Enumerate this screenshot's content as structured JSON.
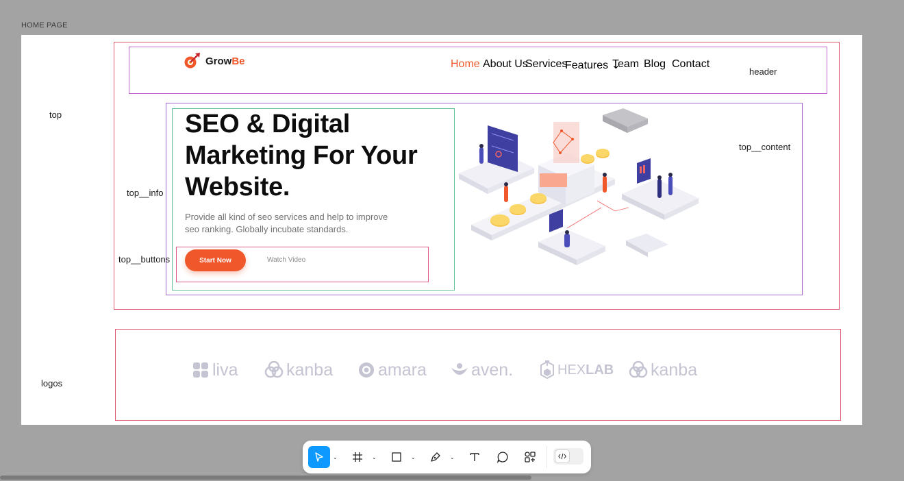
{
  "frame": {
    "title": "HOME PAGE"
  },
  "annotations": {
    "top": "top",
    "header": "header",
    "top_content": "top__content",
    "top_info": "top__info",
    "top_buttons": "top__buttons",
    "logos": "logos"
  },
  "header": {
    "logo_part1": "Grow",
    "logo_part2": "Be",
    "nav": [
      {
        "label": "Home",
        "active": true
      },
      {
        "label": "About Us"
      },
      {
        "label": "Services"
      },
      {
        "label": "Features ⌄"
      },
      {
        "label": "Team"
      },
      {
        "label": "Blog"
      },
      {
        "label": "Contact"
      }
    ]
  },
  "hero": {
    "title": "SEO & Digital Marketing For Your Website.",
    "description": "Provide all kind of seo services and help to improve seo ranking. Globally incubate standards.",
    "primary_button": "Start Now",
    "secondary_button": "Watch Video"
  },
  "logos": [
    {
      "name": "liva"
    },
    {
      "name": "kanba"
    },
    {
      "name": "amara"
    },
    {
      "name": "aven."
    },
    {
      "name": "HEX",
      "name2": "LAB"
    },
    {
      "name": "kanba"
    }
  ],
  "toolbar": {
    "icons": [
      "move-icon",
      "frame-icon",
      "rectangle-icon",
      "pen-icon",
      "text-icon",
      "comment-icon",
      "assets-icon",
      "code-icon"
    ]
  },
  "colors": {
    "accent": "#f0572a",
    "figma_blue": "#0d99ff"
  }
}
